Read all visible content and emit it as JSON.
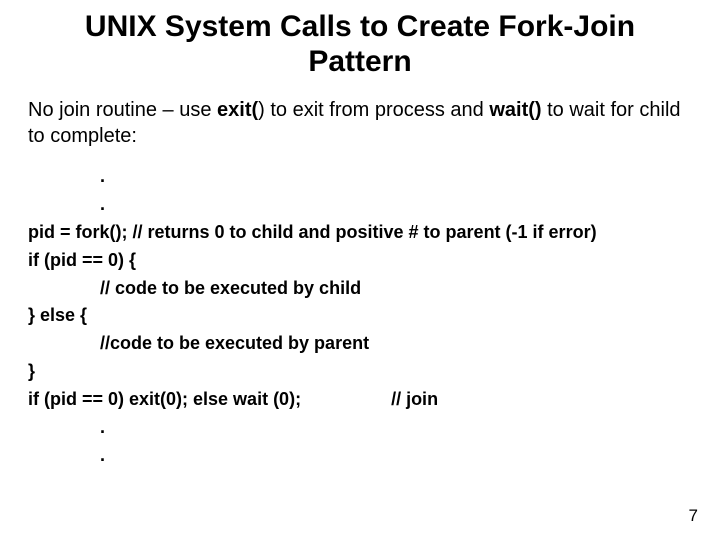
{
  "title": "UNIX System Calls to Create Fork-Join Pattern",
  "intro": {
    "pre": "No join routine – use ",
    "exit": "exit(",
    "afterExit": ") to exit from process and ",
    "wait": "wait()",
    "afterWait": " to wait for child to complete:"
  },
  "code": {
    "l1": ".",
    "l2": ".",
    "l3": "pid = fork(); // returns 0 to child and positive # to parent (-1 if error)",
    "l4": "if (pid == 0) {",
    "l5": "// code to be executed by child",
    "l6": "} else {",
    "l7": "//code to be executed by parent",
    "l8": "}",
    "l9a": "if (pid == 0) exit(0); else wait (0);",
    "l9b": "// join",
    "l10": ".",
    "l11": "."
  },
  "pageNumber": "7"
}
